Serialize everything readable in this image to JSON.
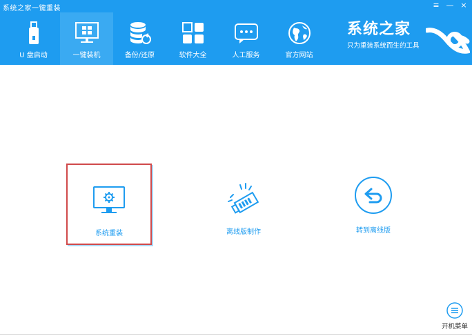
{
  "window": {
    "title": "系统之家一键重装",
    "controls": {
      "menu": "≡",
      "minimize": "—",
      "close": "×"
    }
  },
  "nav": {
    "items": [
      {
        "label": "U 盘启动",
        "icon": "usb-icon",
        "active": false
      },
      {
        "label": "一键装机",
        "icon": "monitor-windows-icon",
        "active": true
      },
      {
        "label": "备份/还原",
        "icon": "database-restore-icon",
        "active": false
      },
      {
        "label": "软件大全",
        "icon": "apps-grid-icon",
        "active": false
      },
      {
        "label": "人工服务",
        "icon": "chat-icon",
        "active": false
      },
      {
        "label": "官方网站",
        "icon": "globe-icon",
        "active": false
      }
    ]
  },
  "brand": {
    "name": "系统之家",
    "slogan": "只为重装系统而生的工具"
  },
  "options": [
    {
      "label": "系统重装",
      "icon": "monitor-gear-icon",
      "selected": true
    },
    {
      "label": "离线版制作",
      "icon": "usb-drive-icon",
      "selected": false
    },
    {
      "label": "转到离线版",
      "icon": "return-arrow-icon",
      "selected": false
    }
  ],
  "bottom_menu": {
    "label": "开机菜单",
    "icon": "hamburger-menu-icon"
  },
  "colors": {
    "header_bg": "#1e9cf0",
    "active_tab": "#3aaaf2",
    "accent": "#1e9cf0",
    "selected_border": "#d0494a"
  }
}
